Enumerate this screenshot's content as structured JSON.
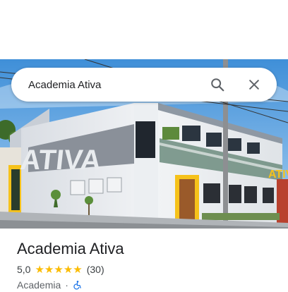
{
  "search": {
    "query": "Academia Ativa",
    "search_icon": "search-icon",
    "close_icon": "close-icon"
  },
  "photo": {
    "sign_text": "ATIVA",
    "facade_sign_text": "ATIVA"
  },
  "place": {
    "title": "Academia Ativa",
    "rating": "5,0",
    "stars": 5,
    "reviews": "(30)",
    "category": "Academia",
    "separator": "·",
    "accessibility_icon": "wheelchair-icon"
  },
  "colors": {
    "star": "#fbbc04",
    "accessibility": "#1a73e8",
    "accent_yellow": "#f6c21a"
  }
}
